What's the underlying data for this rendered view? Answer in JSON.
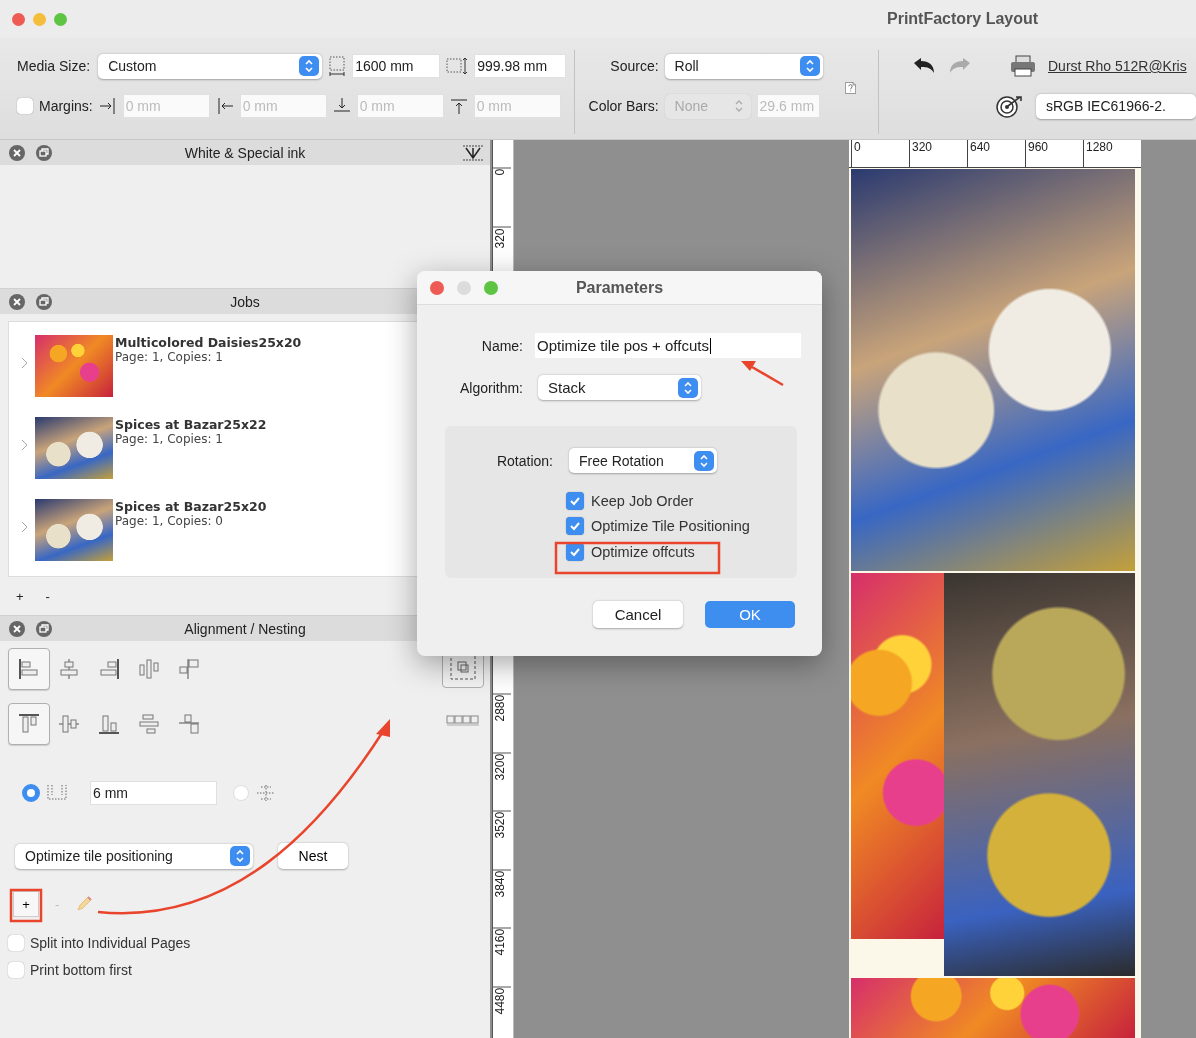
{
  "window": {
    "title": "PrintFactory Layout"
  },
  "toolbar": {
    "media_size": {
      "label": "Media Size:",
      "value": "Custom"
    },
    "width": {
      "value": "1600 mm"
    },
    "height": {
      "value": "999.98 mm"
    },
    "margins": {
      "label": "Margins:",
      "checked": false,
      "fields": [
        {
          "placeholder": "0 mm"
        },
        {
          "placeholder": "0 mm"
        },
        {
          "placeholder": "0 mm"
        },
        {
          "placeholder": "0 mm"
        }
      ]
    },
    "source": {
      "label": "Source:",
      "value": "Roll"
    },
    "color_bars": {
      "label": "Color Bars:",
      "value": "None",
      "disabled": true,
      "size": "29.6 mm"
    },
    "history": [
      {
        "kind": "undo",
        "disabled": false
      },
      {
        "kind": "redo",
        "disabled": true
      }
    ],
    "printer": "Durst Rho 512R@Kris",
    "color_profile": "sRGB IEC61966-2."
  },
  "white_ink_panel": {
    "title": "White & Special ink"
  },
  "jobs_panel": {
    "title": "Jobs",
    "items": [
      {
        "name": "Multicolored Daisies25x20",
        "details": "Page: 1, Copies: 1",
        "kind": "flowers"
      },
      {
        "name": "Spices at Bazar25x22",
        "details": "Page: 1, Copies: 1",
        "kind": "spices"
      },
      {
        "name": "Spices at Bazar25x20",
        "details": "Page: 1, Copies: 0",
        "kind": "spices"
      }
    ],
    "add": "+",
    "remove": "-"
  },
  "alignment_panel": {
    "title": "Alignment / Nesting",
    "align_rows": [
      {
        "buttons": [
          {
            "selected": true
          },
          {
            "selected": false
          },
          {
            "selected": false
          },
          {
            "selected": false
          },
          {
            "selected": false
          }
        ]
      },
      {
        "buttons": [
          {
            "selected": true
          },
          {
            "selected": false
          },
          {
            "selected": false
          },
          {
            "selected": false
          },
          {
            "selected": false
          }
        ]
      }
    ],
    "spacing": [
      {
        "selected": true,
        "value": "6 mm"
      },
      {
        "selected": false
      }
    ],
    "mode": "Optimize tile positioning",
    "nest_button": "Nest",
    "add": "+",
    "remove": "-",
    "options": [
      {
        "label": "Split into Individual Pages",
        "checked": false
      },
      {
        "label": "Print bottom first",
        "checked": false
      }
    ]
  },
  "rulers": {
    "horizontal": [
      "0",
      "320",
      "640",
      "960",
      "1280"
    ],
    "vertical": [
      "0",
      "320",
      "2880",
      "3200",
      "3520",
      "3840",
      "4160",
      "4480"
    ]
  },
  "dialog": {
    "title": "Parameters",
    "name_label": "Name:",
    "name_value": "Optimize tile pos + offcuts",
    "algorithm_label": "Algorithm:",
    "algorithm": "Stack",
    "rotation_label": "Rotation:",
    "rotation": "Free Rotation",
    "options": [
      {
        "label": "Keep Job Order",
        "checked": true
      },
      {
        "label": "Optimize Tile Positioning",
        "checked": true
      },
      {
        "label": "Optimize offcuts",
        "checked": true
      }
    ],
    "buttons": [
      {
        "label": "Cancel",
        "kind": "secondary"
      },
      {
        "label": "OK",
        "kind": "primary"
      }
    ]
  }
}
